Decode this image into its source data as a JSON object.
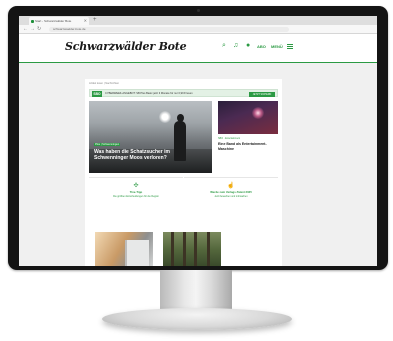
{
  "browser": {
    "tab_title": "Start - Schwarzwälder Bote",
    "tab_close": "✕",
    "tab_new": "+",
    "url": "schwarzwaelder-bote.de"
  },
  "header": {
    "logo": "Schwarzwälder Bote",
    "abo_label": "ABO",
    "menu_label": "MENÜ"
  },
  "breadcrumb": "Artikel lesen  |  Nachrichten",
  "banner": {
    "badge": "SBO",
    "text": "CYBERWEEK-ANGEBOT: SB Plus Basic jetzt 3 Monate für nur 0,99 € lesen",
    "button": "JETZT SICHERN"
  },
  "hero": {
    "tag": "Plus | Schwenningen",
    "title": "Was haben die Schatzsucher im Schwenninger Moos verloren?"
  },
  "side_article": {
    "tag": "SBO · Entertainment",
    "title": "Eine Band als Entertainment-Maschine"
  },
  "features": [
    {
      "icon": "tools-icon",
      "title": "Tine-Tipp",
      "sub": "Die größten Entscheidungen für die Region"
    },
    {
      "icon": "hand-icon",
      "title": "Werde zum Verlags-Talent 2025",
      "sub": "Jetzt bewerben und mitmachen"
    }
  ],
  "colors": {
    "brand_green": "#2b9a43",
    "monitor_bezel": "#141414"
  }
}
